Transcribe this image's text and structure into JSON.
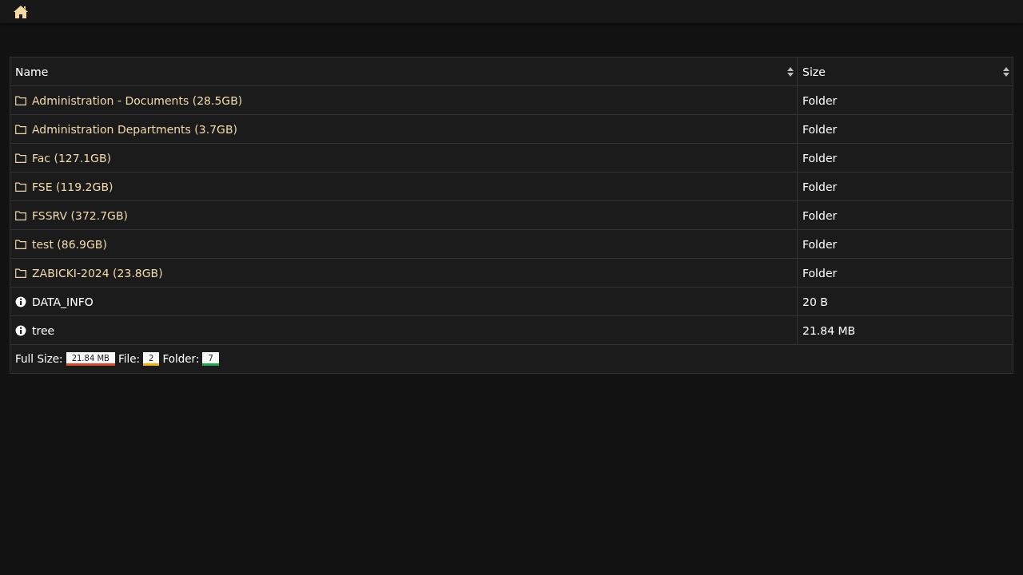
{
  "table": {
    "columns": [
      "Name",
      "Size"
    ],
    "rows": [
      {
        "kind": "folder",
        "name": "Administration - Documents (28.5GB)",
        "size": "Folder"
      },
      {
        "kind": "folder",
        "name": "Administration Departments (3.7GB)",
        "size": "Folder"
      },
      {
        "kind": "folder",
        "name": "Fac (127.1GB)",
        "size": "Folder"
      },
      {
        "kind": "folder",
        "name": "FSE (119.2GB)",
        "size": "Folder"
      },
      {
        "kind": "folder",
        "name": "FSSRV (372.7GB)",
        "size": "Folder"
      },
      {
        "kind": "folder",
        "name": "test (86.9GB)",
        "size": "Folder"
      },
      {
        "kind": "folder",
        "name": "ZABICKI-2024 (23.8GB)",
        "size": "Folder"
      },
      {
        "kind": "file",
        "name": "DATA_INFO",
        "size": "20 B"
      },
      {
        "kind": "file",
        "name": "tree",
        "size": "21.84 MB"
      }
    ],
    "summary": [
      {
        "label": "Full Size:",
        "value": "21.84 MB",
        "color": "#e0442b"
      },
      {
        "label": "File:",
        "value": "2",
        "color": "#f0b400"
      },
      {
        "label": "Folder:",
        "value": "7",
        "color": "#1aa84a"
      }
    ]
  }
}
